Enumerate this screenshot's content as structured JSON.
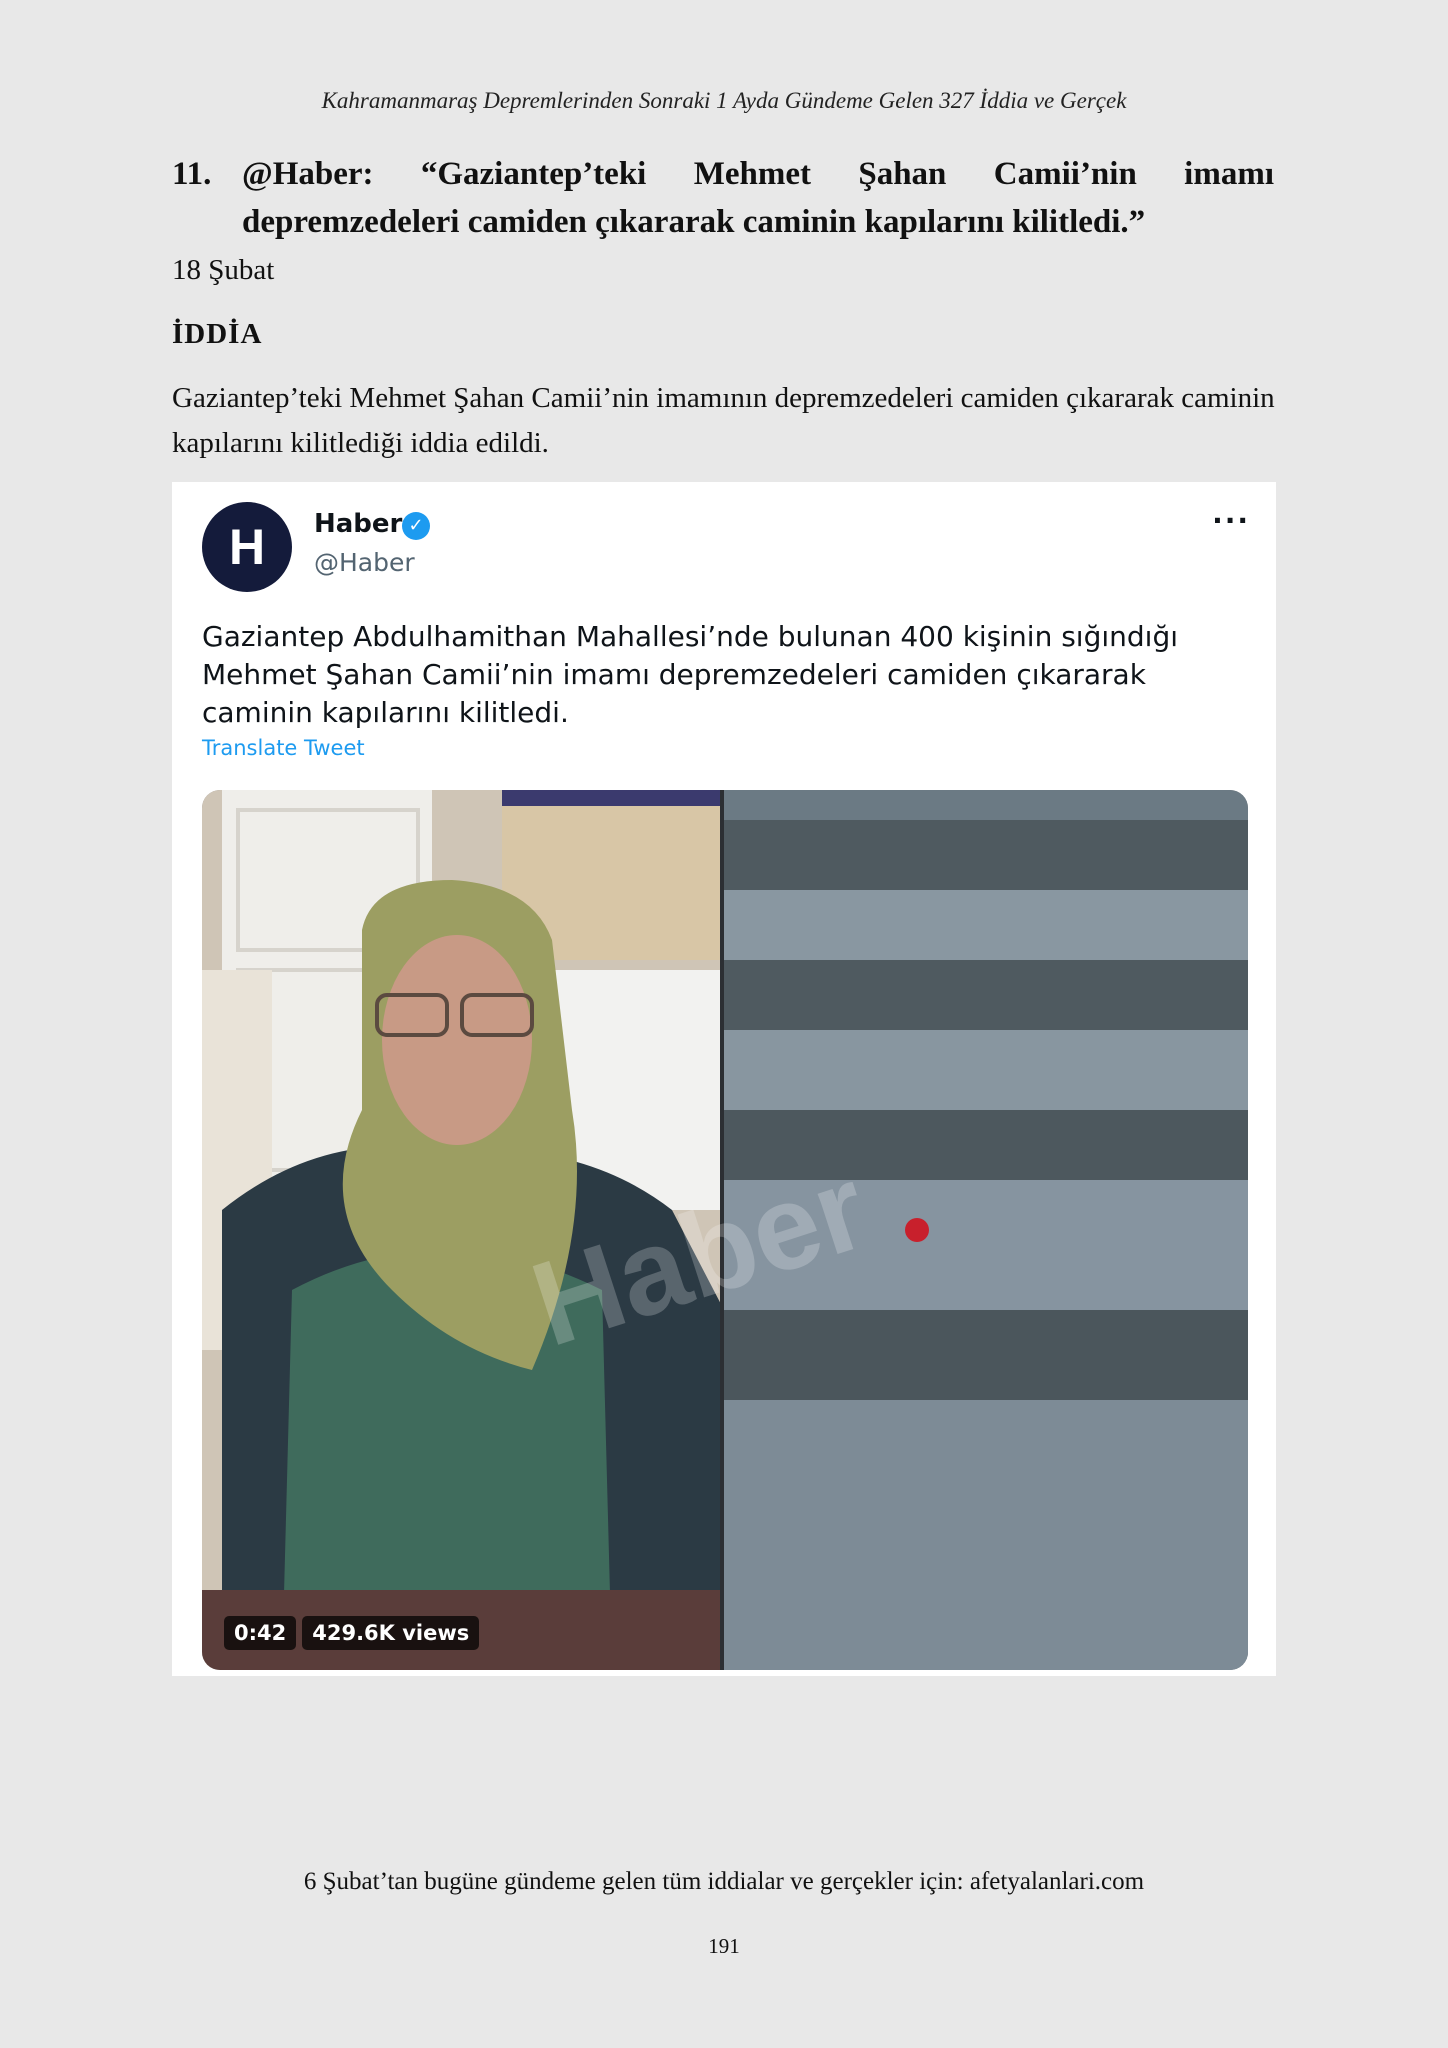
{
  "running_head": "Kahramanmaraş Depremlerinden Sonraki 1 Ayda Gündeme Gelen 327 İddia ve Gerçek",
  "item": {
    "number": "11.",
    "heading": "@Haber: “Gaziantep’teki Mehmet Şahan Camii’nin imamı depremzedeleri camiden çıkararak caminin kapılarını kilitledi.”",
    "date": "18 Şubat",
    "section_label": "İDDİA",
    "claim_text": "Gaziantep’teki Mehmet Şahan Camii’nin imamının depremzedeleri camiden çıkararak caminin kapılarını kilitlediği iddia edildi."
  },
  "tweet": {
    "avatar_letter": "H",
    "display_name": "Haber",
    "handle": "@Haber",
    "more_label": "···",
    "text": "Gaziantep Abdulhamithan Mahallesi’nde bulunan 400 kişinin sığındığı Mehmet Şahan Camii’nin imamı depremzedeleri camiden çıkararak caminin kapılarını kilitledi.",
    "translate_label": "Translate Tweet",
    "video_duration": "0:42",
    "video_views": "429.6K views",
    "colors": {
      "verified": "#1d9bf0",
      "avatar_bg": "#141b3b",
      "link": "#1d9bf0"
    }
  },
  "footer_note": "6 Şubat’tan bugüne gündeme gelen tüm iddialar ve gerçekler için: afetyalanlari.com",
  "page_number": "191"
}
